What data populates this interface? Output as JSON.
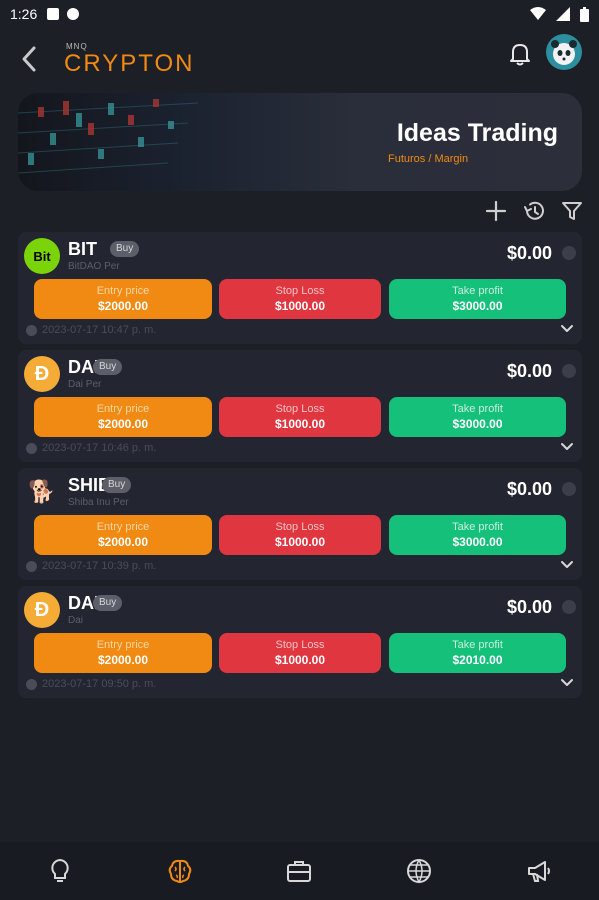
{
  "status": {
    "time": "1:26"
  },
  "header": {
    "brand_small": "MNQ",
    "brand": "CRYPTON"
  },
  "banner": {
    "title": "Ideas Trading",
    "subtitle": "Futuros / Margin"
  },
  "labels": {
    "entry": "Entry price",
    "stop": "Stop Loss",
    "take": "Take profit"
  },
  "ideas": [
    {
      "symbol": "BIT",
      "side": "Buy",
      "pair": "BitDAO Per",
      "amount": "$0.00",
      "entry": "$2000.00",
      "stop": "$1000.00",
      "take": "$3000.00",
      "date": "2023-07-17 10:47 p. m.",
      "icon_text": "Bit",
      "icon_color": "#7bd40a",
      "icon": "bitdao-coin-icon"
    },
    {
      "symbol": "DAI",
      "side": "Buy",
      "pair": "Dai Per",
      "amount": "$0.00",
      "entry": "$2000.00",
      "stop": "$1000.00",
      "take": "$3000.00",
      "date": "2023-07-17 10:46 p. m.",
      "icon_text": "Ð",
      "icon_color": "#f5ac37",
      "icon": "dai-coin-icon"
    },
    {
      "symbol": "SHIB",
      "side": "Buy",
      "pair": "Shiba Inu Per",
      "amount": "$0.00",
      "entry": "$2000.00",
      "stop": "$1000.00",
      "take": "$3000.00",
      "date": "2023-07-17 10:39 p. m.",
      "icon_text": "🐕",
      "icon_color": "#e42d04",
      "icon": "shiba-coin-icon"
    },
    {
      "symbol": "DAI",
      "side": "Buy",
      "pair": "Dai",
      "amount": "$0.00",
      "entry": "$2000.00",
      "stop": "$1000.00",
      "take": "$2010.00",
      "date": "2023-07-17 09:50 p. m.",
      "icon_text": "Ð",
      "icon_color": "#f5ac37",
      "icon": "dai-coin-icon"
    }
  ],
  "colors": {
    "accent": "#f08a12",
    "entry": "#f08a12",
    "stop": "#e0363f",
    "take": "#14c07a",
    "background": "#1d1f27",
    "card": "#232631"
  },
  "nav": [
    {
      "icon": "lightbulb-icon",
      "active": false
    },
    {
      "icon": "brain-icon",
      "active": true
    },
    {
      "icon": "briefcase-icon",
      "active": false
    },
    {
      "icon": "globe-icon",
      "active": false
    },
    {
      "icon": "megaphone-icon",
      "active": false
    }
  ]
}
